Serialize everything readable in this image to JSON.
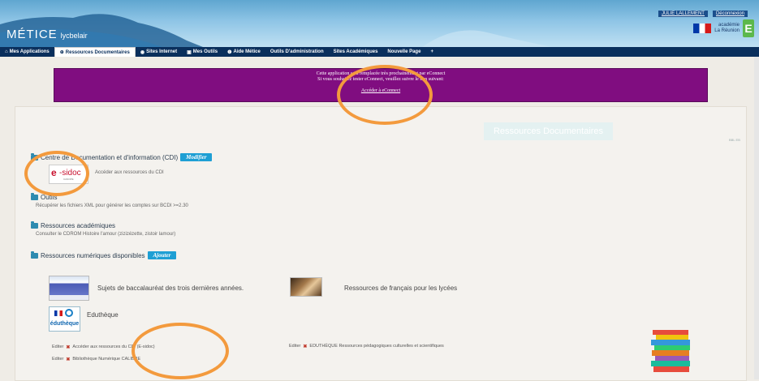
{
  "header": {
    "brand": "MÉTICE",
    "brand_sub": "lycbelair",
    "user_link": "JULIE LALLEMENT",
    "logout_link": "Déconnexion",
    "academy_line1": "académie",
    "academy_line2": "La Réunion",
    "academy_letter": "E"
  },
  "nav": {
    "items": [
      {
        "icon": "home-icon",
        "glyph": "⌂",
        "label": "Mes Applications"
      },
      {
        "icon": "globe-icon",
        "glyph": "⊕",
        "label": "Ressources Documentaires"
      },
      {
        "icon": "web-icon",
        "glyph": "◉",
        "label": "Sites Internet"
      },
      {
        "icon": "tools-icon",
        "glyph": "▣",
        "label": "Mes Outils"
      },
      {
        "icon": "help-icon",
        "glyph": "❶",
        "label": "Aide Métice"
      },
      {
        "icon": "",
        "glyph": "",
        "label": "Outils D'administration"
      },
      {
        "icon": "",
        "glyph": "",
        "label": "Sites Académiques"
      },
      {
        "icon": "",
        "glyph": "",
        "label": "Nouvelle Page"
      },
      {
        "icon": "plus-icon",
        "glyph": "+",
        "label": ""
      }
    ]
  },
  "notice": {
    "line1": "Cette application sera remplacée très prochainement par eConnect",
    "line2": "Si vous souhaitez tester eConnect, veuillez suivre le lien suivant:",
    "link": "Accéder à eConnect"
  },
  "main": {
    "title": "Ressources Documentaires",
    "small_links": "BBL EB"
  },
  "sections": {
    "cdi": {
      "title": "Centre de Documentation et d'information (CDI)",
      "button": "Modifier",
      "esidoc_e": "e",
      "esidoc_t": "-sidoc",
      "esidoc_sub": "CANOPE",
      "item": "Accéder aux ressources du CDI"
    },
    "outils": {
      "title": "Outils",
      "item": "Récupérer les fichiers XML pour générer les comptes sur BCDI >=2.30"
    },
    "acad": {
      "title": "Ressources académiques",
      "item": "Consulter le CDROM Histoire l'amour (zizizézette, zistoir lamour)"
    },
    "num": {
      "title": "Ressources numériques disponibles",
      "button": "Ajouter"
    }
  },
  "resources": {
    "bac": "Sujets de baccalauréat des trois dernières années.",
    "francais": "Ressources de français pour les lycées",
    "edutheque": "Eduthèque",
    "edutheque_logo": "éduthèque"
  },
  "edit_links": {
    "edit_label": "Editer",
    "row1": "Accéder aux ressources du CDI (E-sidoc)",
    "row2": "Bibliothèque Numérique CALIBRE",
    "row3": "EDUTHÈQUE Ressources pédagogiques culturelles et scientifiques"
  },
  "colors": {
    "nav_bg": "#0a2f5c",
    "notice_bg": "#800d80",
    "button_bg": "#1e9fd4",
    "annotation": "#f39a3d"
  }
}
